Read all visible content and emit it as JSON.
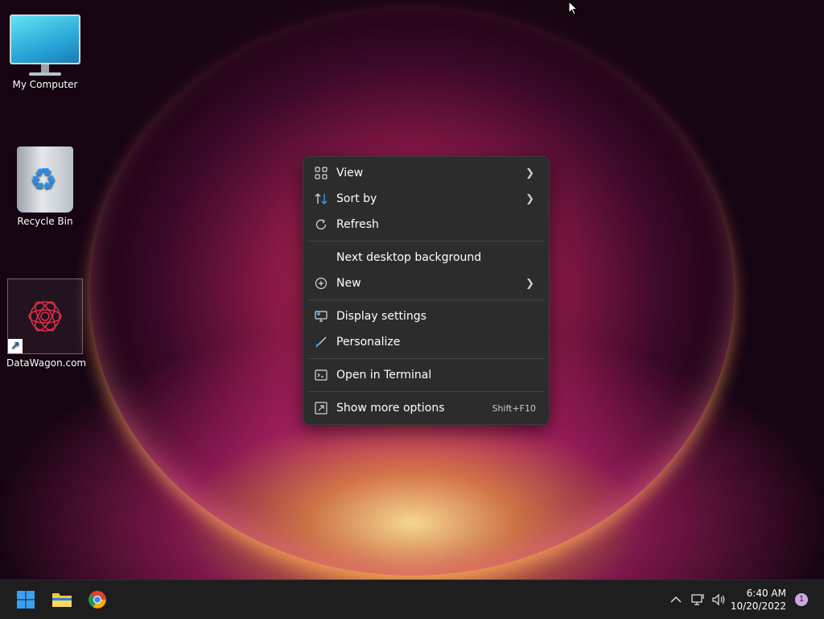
{
  "desktop": {
    "icons": [
      {
        "label": "My Computer"
      },
      {
        "label": "Recycle Bin"
      },
      {
        "label": "DataWagon.com"
      }
    ]
  },
  "context_menu": {
    "items": {
      "view": {
        "label": "View",
        "icon": "grid-icon"
      },
      "sort_by": {
        "label": "Sort by",
        "icon": "sort-icon"
      },
      "refresh": {
        "label": "Refresh",
        "icon": "refresh-icon"
      },
      "next_bg": {
        "label": "Next desktop background"
      },
      "new": {
        "label": "New",
        "icon": "plus-circle-icon"
      },
      "display": {
        "label": "Display settings",
        "icon": "display-icon"
      },
      "personalize": {
        "label": "Personalize",
        "icon": "brush-icon"
      },
      "terminal": {
        "label": "Open in Terminal",
        "icon": "terminal-icon"
      },
      "more": {
        "label": "Show more options",
        "shortcut": "Shift+F10",
        "icon": "expand-icon"
      }
    }
  },
  "taskbar": {
    "clock_time": "6:40 AM",
    "clock_date": "10/20/2022",
    "notification_count": "1"
  },
  "colors": {
    "menu_bg": "#2c2c2c",
    "taskbar_bg": "#1e1e1e",
    "accent_blue": "#3aa0f3",
    "notification_badge": "#cfa7e6"
  }
}
